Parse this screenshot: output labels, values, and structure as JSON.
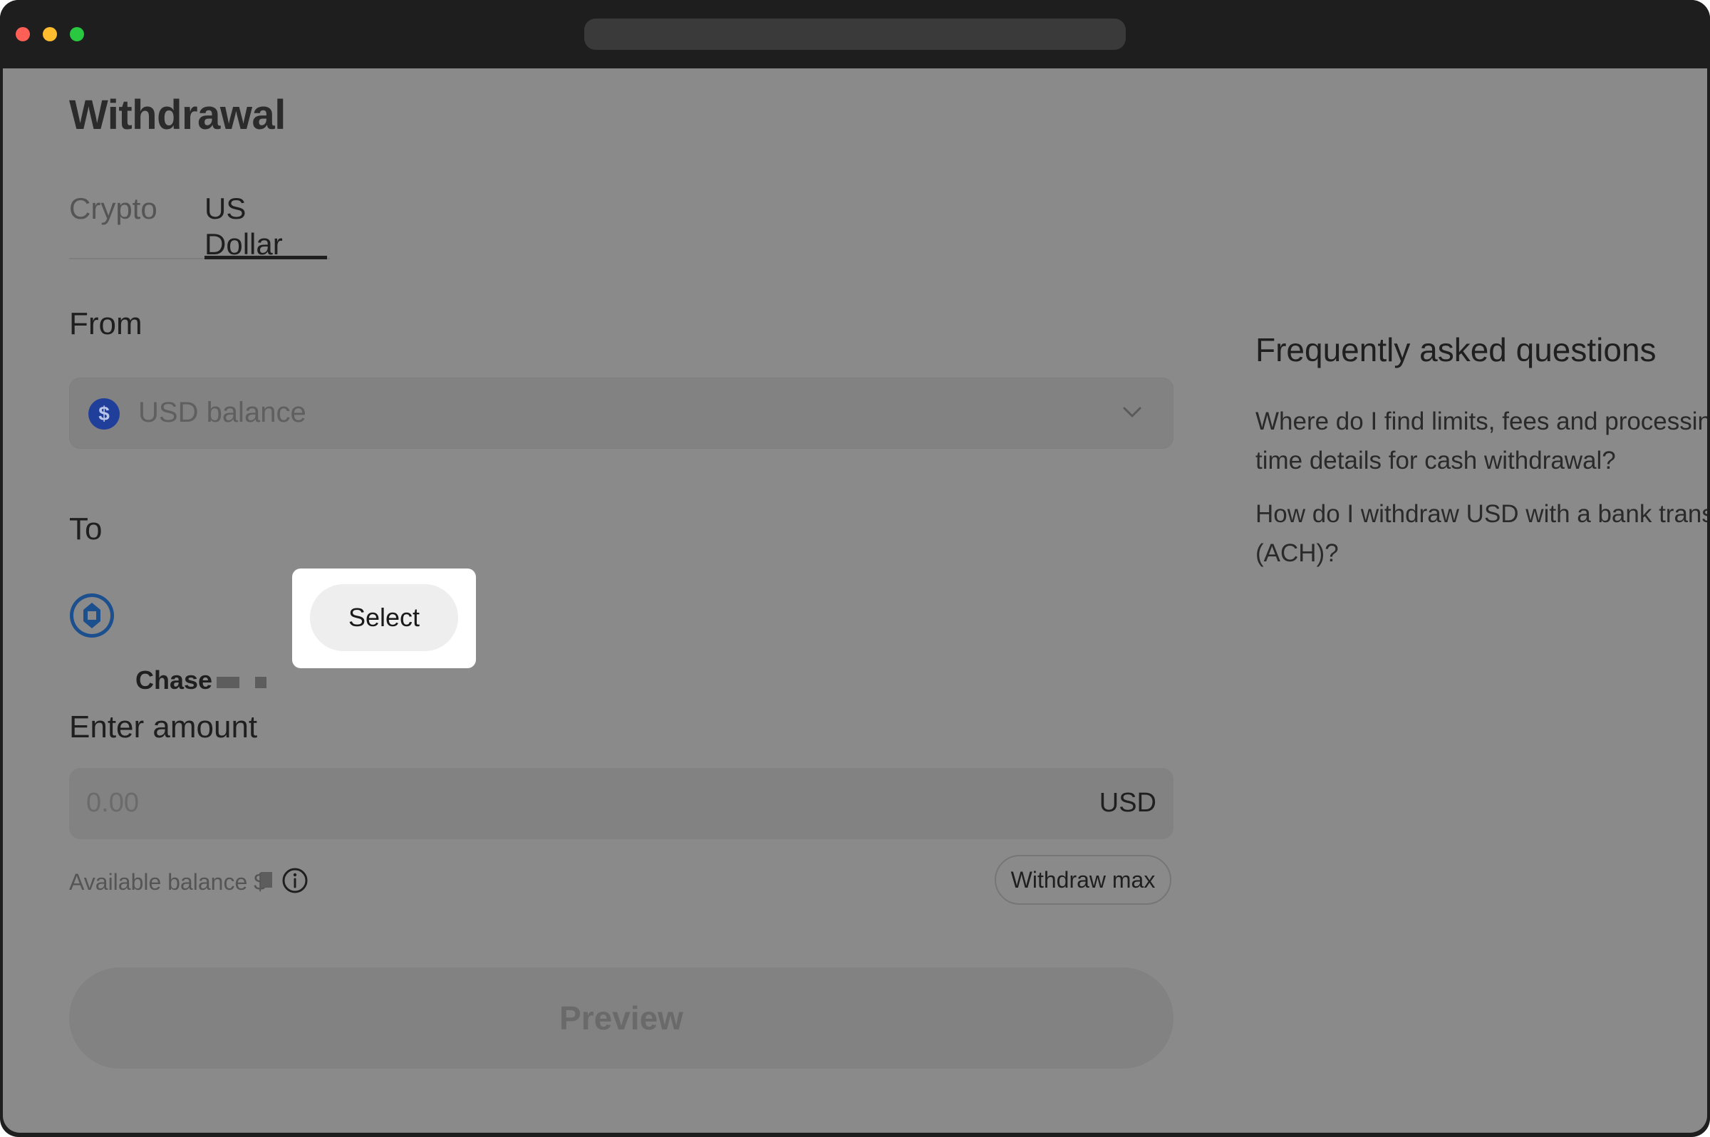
{
  "window": {
    "traffic_lights": {
      "close_color": "#fe5f57",
      "minimize_color": "#febc2e",
      "zoom_color": "#28c840"
    }
  },
  "page": {
    "title": "Withdrawal",
    "tabs": [
      {
        "label": "Crypto",
        "active": false
      },
      {
        "label": "US Dollar",
        "active": true
      }
    ]
  },
  "from": {
    "label": "From",
    "select_value": "USD balance",
    "coin_symbol": "$",
    "dropdown_icon": "chevron-down-icon"
  },
  "to": {
    "label": "To",
    "bank_name": "Chase",
    "bank_icon": "chase-bank-icon",
    "select_label": "Select"
  },
  "amount": {
    "label": "Enter amount",
    "placeholder": "0.00",
    "currency": "USD",
    "available_label": "Available balance $",
    "info_icon": "info-icon",
    "withdraw_max_label": "Withdraw max"
  },
  "actions": {
    "preview_label": "Preview"
  },
  "faq": {
    "title": "Frequently asked questions",
    "items": [
      {
        "text": "Where do I find limits, fees and processing time details for cash withdrawal?"
      },
      {
        "text": "How do I withdraw USD with a bank transfer (ACH)?"
      }
    ]
  },
  "colors": {
    "overlay": "#8a8a8a",
    "chrome": "#1e1e1e",
    "coin_blue": "#1f3f9a",
    "chase_blue": "#1b4f8e"
  }
}
